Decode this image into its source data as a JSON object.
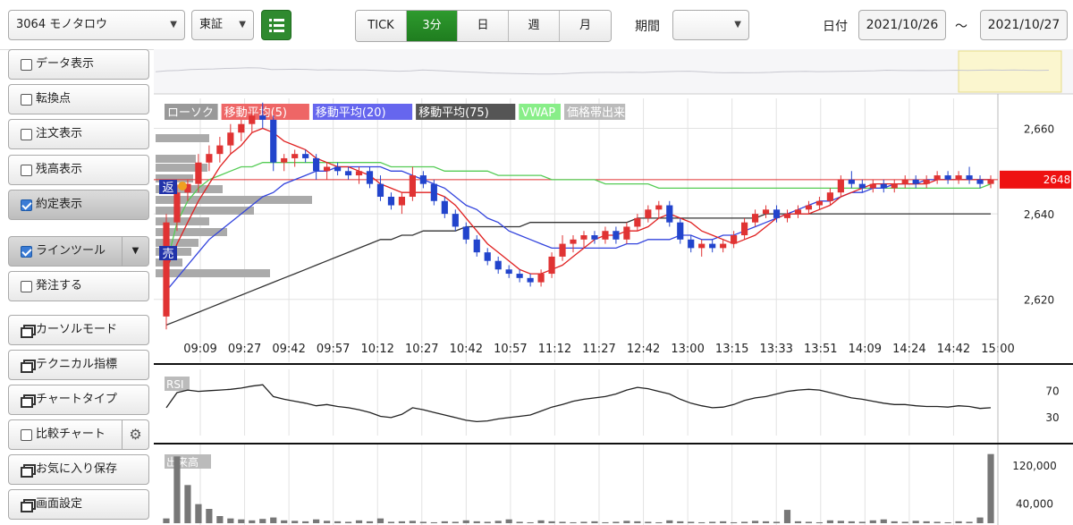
{
  "header": {
    "symbol_select": "3064 モノタロウ",
    "exchange_select": "東証",
    "timeframes": [
      {
        "label": "TICK",
        "active": false
      },
      {
        "label": "3分",
        "active": true
      },
      {
        "label": "日",
        "active": false
      },
      {
        "label": "週",
        "active": false
      },
      {
        "label": "月",
        "active": false
      }
    ],
    "period_label": "期間",
    "period_value": "",
    "date_label": "日付",
    "date_from": "2021/10/26",
    "date_sep": "～",
    "date_to": "2021/10/27"
  },
  "sidebar": {
    "items": [
      {
        "label": "データ表示",
        "kind": "checkbox",
        "checked": false
      },
      {
        "label": "転換点",
        "kind": "checkbox",
        "checked": false
      },
      {
        "label": "注文表示",
        "kind": "checkbox",
        "checked": false
      },
      {
        "label": "残高表示",
        "kind": "checkbox",
        "checked": false
      },
      {
        "label": "約定表示",
        "kind": "checkbox",
        "checked": true
      },
      {
        "label": "ラインツール",
        "kind": "checkbox-dropdown",
        "checked": true
      },
      {
        "label": "発注する",
        "kind": "checkbox",
        "checked": false
      },
      {
        "label": "カーソルモード",
        "kind": "window"
      },
      {
        "label": "テクニカル指標",
        "kind": "window"
      },
      {
        "label": "チャートタイプ",
        "kind": "window"
      },
      {
        "label": "比較チャート",
        "kind": "checkbox-gear",
        "checked": false
      },
      {
        "label": "お気に入り保存",
        "kind": "window"
      },
      {
        "label": "画面設定",
        "kind": "window"
      }
    ]
  },
  "legend": [
    {
      "label": "ローソク",
      "color": "#999999",
      "text": "#ffffff"
    },
    {
      "label": "移動平均(5)",
      "color": "#ee6666",
      "text": "#ffffff"
    },
    {
      "label": "移動平均(20)",
      "color": "#6666ee",
      "text": "#ffffff"
    },
    {
      "label": "移動平均(75)",
      "color": "#555555",
      "text": "#ffffff"
    },
    {
      "label": "VWAP",
      "color": "#88ee88",
      "text": "#ffffff"
    },
    {
      "label": "価格帯出来",
      "color": "#bbbbbb",
      "text": "#ffffff"
    }
  ],
  "markers": {
    "buy_back": "返",
    "sell": "売"
  },
  "chart_data": {
    "type": "candlestick",
    "x_ticks": [
      "09:09",
      "09:27",
      "09:42",
      "09:57",
      "10:12",
      "10:27",
      "10:42",
      "10:57",
      "11:12",
      "11:27",
      "12:42",
      "13:00",
      "13:15",
      "13:33",
      "13:51",
      "14:09",
      "14:24",
      "14:42",
      "15:00"
    ],
    "y_ticks": [
      "2,660",
      "2,640",
      "2,620"
    ],
    "ylim": [
      2612,
      2667
    ],
    "current_price": "2648",
    "current_price_value": 2648,
    "candles": [
      [
        2616,
        2640,
        2613,
        2638
      ],
      [
        2638,
        2647,
        2636,
        2645
      ],
      [
        2645,
        2648,
        2643,
        2647
      ],
      [
        2647,
        2654,
        2645,
        2652
      ],
      [
        2652,
        2656,
        2650,
        2654
      ],
      [
        2654,
        2658,
        2652,
        2656
      ],
      [
        2656,
        2661,
        2654,
        2659
      ],
      [
        2659,
        2662,
        2657,
        2661
      ],
      [
        2661,
        2664,
        2659,
        2663
      ],
      [
        2663,
        2666,
        2660,
        2662
      ],
      [
        2662,
        2663,
        2650,
        2652
      ],
      [
        2652,
        2654,
        2650,
        2653
      ],
      [
        2653,
        2655,
        2651,
        2654
      ],
      [
        2654,
        2655,
        2652,
        2653
      ],
      [
        2653,
        2654,
        2648,
        2650
      ],
      [
        2650,
        2652,
        2648,
        2651
      ],
      [
        2651,
        2652,
        2649,
        2650
      ],
      [
        2650,
        2651,
        2648,
        2649
      ],
      [
        2649,
        2651,
        2647,
        2650
      ],
      [
        2650,
        2651,
        2646,
        2647
      ],
      [
        2647,
        2649,
        2643,
        2644
      ],
      [
        2644,
        2645,
        2641,
        2642
      ],
      [
        2642,
        2645,
        2640,
        2644
      ],
      [
        2644,
        2651,
        2643,
        2649
      ],
      [
        2649,
        2650,
        2646,
        2647
      ],
      [
        2647,
        2648,
        2642,
        2643
      ],
      [
        2643,
        2644,
        2639,
        2640
      ],
      [
        2640,
        2641,
        2636,
        2637
      ],
      [
        2637,
        2638,
        2633,
        2634
      ],
      [
        2634,
        2635,
        2630,
        2631
      ],
      [
        2631,
        2632,
        2628,
        2629
      ],
      [
        2629,
        2630,
        2626,
        2627
      ],
      [
        2627,
        2628,
        2625,
        2626
      ],
      [
        2626,
        2627,
        2624,
        2625
      ],
      [
        2625,
        2626,
        2623,
        2624
      ],
      [
        2624,
        2627,
        2623,
        2626
      ],
      [
        2626,
        2631,
        2625,
        2630
      ],
      [
        2630,
        2635,
        2629,
        2633
      ],
      [
        2633,
        2635,
        2631,
        2634
      ],
      [
        2634,
        2636,
        2632,
        2635
      ],
      [
        2635,
        2636,
        2633,
        2634
      ],
      [
        2634,
        2637,
        2633,
        2636
      ],
      [
        2636,
        2637,
        2633,
        2634
      ],
      [
        2634,
        2638,
        2633,
        2637
      ],
      [
        2637,
        2640,
        2636,
        2639
      ],
      [
        2639,
        2642,
        2638,
        2641
      ],
      [
        2641,
        2643,
        2639,
        2642
      ],
      [
        2642,
        2643,
        2637,
        2638
      ],
      [
        2638,
        2639,
        2633,
        2634
      ],
      [
        2634,
        2635,
        2631,
        2632
      ],
      [
        2632,
        2634,
        2630,
        2633
      ],
      [
        2633,
        2634,
        2631,
        2632
      ],
      [
        2632,
        2634,
        2631,
        2633
      ],
      [
        2633,
        2636,
        2632,
        2635
      ],
      [
        2635,
        2639,
        2634,
        2638
      ],
      [
        2638,
        2641,
        2637,
        2640
      ],
      [
        2640,
        2642,
        2639,
        2641
      ],
      [
        2641,
        2642,
        2638,
        2639
      ],
      [
        2639,
        2641,
        2638,
        2640
      ],
      [
        2640,
        2642,
        2639,
        2641
      ],
      [
        2641,
        2643,
        2640,
        2642
      ],
      [
        2642,
        2644,
        2641,
        2643
      ],
      [
        2643,
        2646,
        2642,
        2645
      ],
      [
        2645,
        2649,
        2644,
        2648
      ],
      [
        2648,
        2650,
        2646,
        2647
      ],
      [
        2647,
        2648,
        2645,
        2646
      ],
      [
        2646,
        2648,
        2645,
        2647
      ],
      [
        2647,
        2648,
        2645,
        2646
      ],
      [
        2646,
        2648,
        2645,
        2647
      ],
      [
        2647,
        2649,
        2646,
        2648
      ],
      [
        2648,
        2649,
        2646,
        2647
      ],
      [
        2647,
        2649,
        2646,
        2648
      ],
      [
        2648,
        2650,
        2647,
        2649
      ],
      [
        2649,
        2650,
        2647,
        2648
      ],
      [
        2648,
        2650,
        2647,
        2649
      ],
      [
        2649,
        2651,
        2647,
        2648
      ],
      [
        2648,
        2649,
        2646,
        2647
      ],
      [
        2647,
        2649,
        2646,
        2648
      ]
    ],
    "ma5": [
      2627,
      2633,
      2638,
      2643,
      2647,
      2651,
      2654,
      2656,
      2659,
      2660,
      2659,
      2657,
      2656,
      2655,
      2653,
      2652,
      2651,
      2651,
      2650,
      2649,
      2647,
      2646,
      2645,
      2645,
      2645,
      2645,
      2644,
      2642,
      2639,
      2636,
      2633,
      2631,
      2629,
      2627,
      2626,
      2626,
      2627,
      2628,
      2630,
      2632,
      2634,
      2635,
      2635,
      2636,
      2636,
      2637,
      2639,
      2640,
      2639,
      2638,
      2636,
      2635,
      2634,
      2633,
      2634,
      2635,
      2637,
      2639,
      2640,
      2640,
      2640,
      2641,
      2642,
      2644,
      2645,
      2646,
      2647,
      2647,
      2647,
      2647,
      2647,
      2647,
      2648,
      2648,
      2648,
      2648,
      2648,
      2648
    ],
    "ma20": [
      2622,
      2625,
      2628,
      2631,
      2634,
      2636,
      2638,
      2640,
      2642,
      2644,
      2645,
      2647,
      2648,
      2649,
      2650,
      2650,
      2651,
      2651,
      2651,
      2651,
      2651,
      2650,
      2650,
      2649,
      2648,
      2647,
      2646,
      2644,
      2642,
      2641,
      2639,
      2638,
      2636,
      2635,
      2634,
      2633,
      2632,
      2632,
      2632,
      2632,
      2632,
      2632,
      2632,
      2633,
      2633,
      2634,
      2634,
      2634,
      2635,
      2635,
      2634,
      2634,
      2635,
      2635,
      2636,
      2637,
      2638,
      2639,
      2640,
      2641,
      2642,
      2643,
      2643,
      2644,
      2645,
      2645,
      2646,
      2646,
      2647,
      2647,
      2647,
      2648,
      2648,
      2648,
      2648,
      2648,
      2648,
      2648
    ],
    "ma75": [
      2614,
      2615,
      2616,
      2617,
      2618,
      2619,
      2620,
      2621,
      2622,
      2623,
      2624,
      2625,
      2626,
      2627,
      2628,
      2629,
      2630,
      2631,
      2632,
      2633,
      2634,
      2634,
      2635,
      2635,
      2636,
      2636,
      2636,
      2636,
      2637,
      2637,
      2637,
      2637,
      2637,
      2637,
      2638,
      2638,
      2638,
      2638,
      2638,
      2638,
      2638,
      2638,
      2638,
      2638,
      2639,
      2639,
      2639,
      2639,
      2639,
      2639,
      2639,
      2639,
      2639,
      2639,
      2639,
      2639,
      2640,
      2640,
      2640,
      2640,
      2640,
      2640,
      2640,
      2640,
      2640,
      2640,
      2640,
      2640,
      2640,
      2640,
      2640,
      2640,
      2640,
      2640,
      2640,
      2640,
      2640,
      2640
    ],
    "vwap": [
      2628,
      2638,
      2643,
      2646,
      2648,
      2649,
      2650,
      2651,
      2651,
      2652,
      2652,
      2652,
      2652,
      2652,
      2652,
      2652,
      2652,
      2652,
      2652,
      2652,
      2652,
      2651,
      2651,
      2651,
      2651,
      2651,
      2650,
      2650,
      2650,
      2650,
      2650,
      2649,
      2649,
      2649,
      2649,
      2649,
      2648,
      2648,
      2648,
      2648,
      2648,
      2647,
      2647,
      2647,
      2647,
      2647,
      2646,
      2646,
      2646,
      2646,
      2646,
      2646,
      2646,
      2646,
      2646,
      2646,
      2646,
      2646,
      2646,
      2646,
      2646,
      2646,
      2646,
      2646,
      2646,
      2646,
      2646,
      2646,
      2646,
      2646,
      2646,
      2646,
      2646,
      2646,
      2646,
      2646,
      2646,
      2647
    ],
    "rsi_label": "RSI",
    "rsi_ticks": [
      "70",
      "30"
    ],
    "rsi": [
      45,
      68,
      72,
      70,
      71,
      72,
      73,
      75,
      78,
      80,
      62,
      58,
      55,
      52,
      48,
      50,
      47,
      45,
      42,
      38,
      32,
      30,
      35,
      45,
      42,
      38,
      34,
      30,
      26,
      24,
      25,
      28,
      30,
      32,
      34,
      40,
      46,
      50,
      55,
      58,
      60,
      62,
      66,
      72,
      76,
      74,
      70,
      66,
      58,
      52,
      48,
      45,
      46,
      50,
      56,
      60,
      62,
      66,
      70,
      72,
      73,
      72,
      68,
      64,
      60,
      58,
      55,
      52,
      50,
      50,
      48,
      47,
      47,
      46,
      48,
      47,
      44,
      45
    ],
    "volume_label": "出来高",
    "volume_ticks": [
      "120,000",
      "40,000"
    ],
    "volume": [
      10000,
      140000,
      80000,
      40000,
      30000,
      15000,
      10000,
      8000,
      6000,
      9000,
      12000,
      6000,
      5000,
      4000,
      8000,
      5000,
      4000,
      3000,
      6000,
      4000,
      10000,
      3000,
      4000,
      5000,
      3000,
      2000,
      4000,
      3000,
      6000,
      4000,
      3000,
      5000,
      8000,
      3000,
      2000,
      6000,
      4000,
      3000,
      2000,
      3000,
      4000,
      2000,
      3000,
      5000,
      4000,
      3000,
      2000,
      6000,
      4000,
      3000,
      2000,
      3000,
      4000,
      2000,
      3000,
      5000,
      4000,
      3000,
      28000,
      4000,
      3000,
      2000,
      6000,
      5000,
      4000,
      3000,
      6000,
      8000,
      4000,
      3000,
      5000,
      4000,
      3000,
      2000,
      4000,
      3000,
      12000,
      145000
    ]
  }
}
